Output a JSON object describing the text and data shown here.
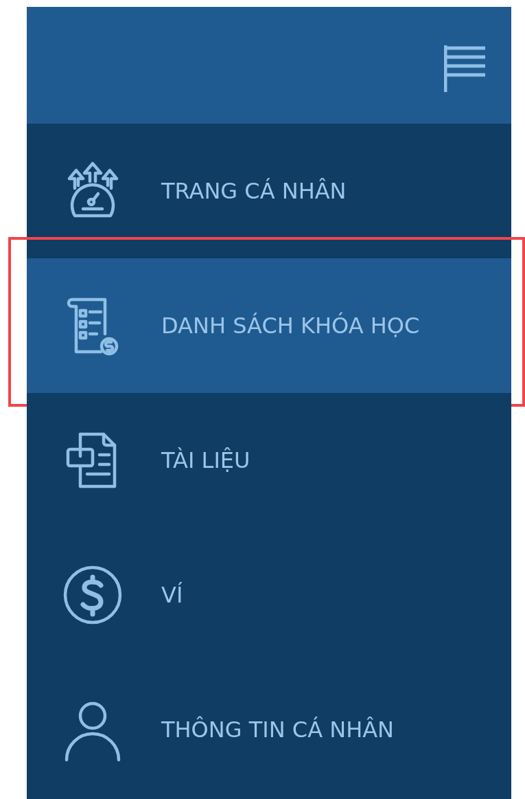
{
  "menu": {
    "items": [
      {
        "label": "TRANG CÁ NHÂN",
        "selected": false,
        "highlighted": false
      },
      {
        "label": "DANH SÁCH KHÓA HỌC",
        "selected": true,
        "highlighted": true
      },
      {
        "label": "TÀI LIỆU",
        "selected": false,
        "highlighted": false
      },
      {
        "label": "VÍ",
        "selected": false,
        "highlighted": false
      },
      {
        "label": "THÔNG TIN CÁ NHÂN",
        "selected": false,
        "highlighted": false
      }
    ]
  }
}
